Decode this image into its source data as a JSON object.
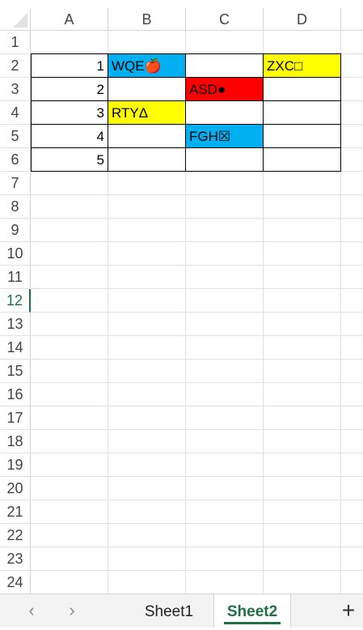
{
  "columns": [
    "A",
    "B",
    "C",
    "D"
  ],
  "rows": [
    "1",
    "2",
    "3",
    "4",
    "5",
    "6",
    "7",
    "8",
    "9",
    "10",
    "11",
    "12",
    "13",
    "14",
    "15",
    "16",
    "17",
    "18",
    "19",
    "20",
    "21",
    "22",
    "23",
    "24"
  ],
  "active_row": "12",
  "cells": {
    "A2": "1",
    "A3": "2",
    "A4": "3",
    "A5": "4",
    "A6": "5",
    "B2": "WQE🍎",
    "C3": "ASD●",
    "B4": "RTYΔ",
    "C5": "FGH☒",
    "D2": "ZXC□"
  },
  "fills": {
    "B2": "#00b0f0",
    "D2": "#ffff00",
    "C3": "#ff0000",
    "B4": "#ffff00",
    "C5": "#00b0f0"
  },
  "sheet_tabs": [
    "Sheet1",
    "Sheet2"
  ],
  "active_sheet": "Sheet2",
  "nav": {
    "prev_icon": "‹",
    "next_icon": "›",
    "add_icon": "+"
  }
}
